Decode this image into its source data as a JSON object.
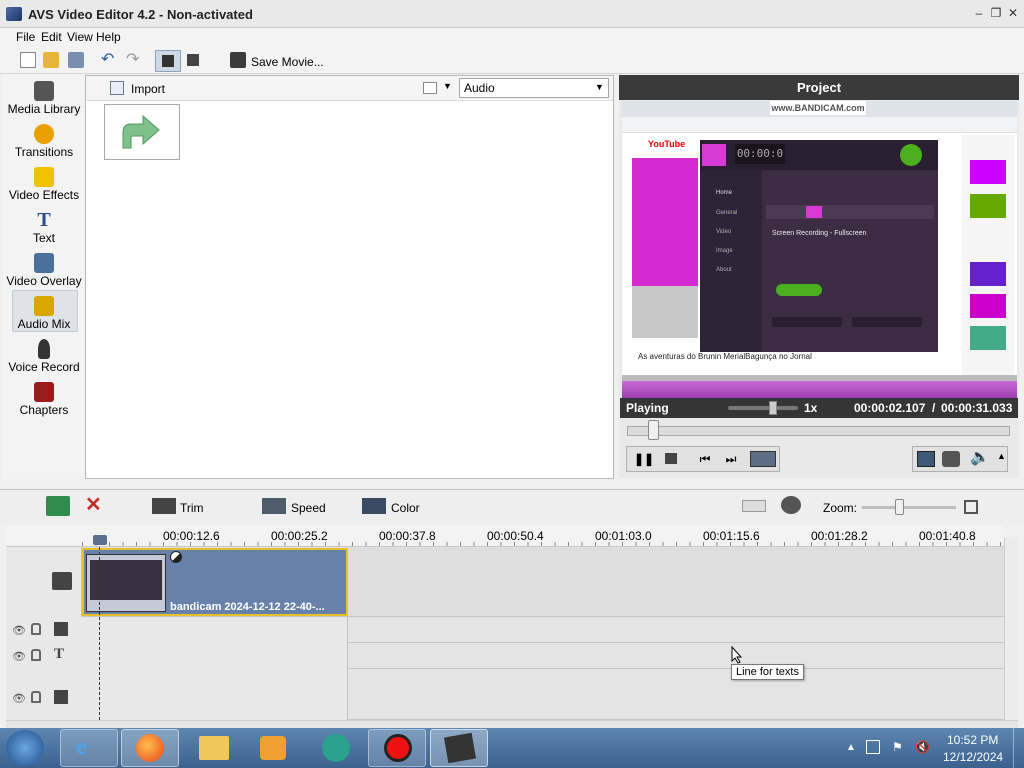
{
  "window": {
    "title": "AVS Video Editor 4.2 - Non-activated"
  },
  "menu": [
    "File",
    "Edit",
    "View",
    "Help"
  ],
  "toolbar": {
    "save_movie": "Save Movie..."
  },
  "sidebar": [
    {
      "label": "Media Library"
    },
    {
      "label": "Transitions"
    },
    {
      "label": "Video Effects"
    },
    {
      "label": "Text"
    },
    {
      "label": "Video Overlay"
    },
    {
      "label": "Audio Mix"
    },
    {
      "label": "Voice Record"
    },
    {
      "label": "Chapters"
    }
  ],
  "library": {
    "import_label": "Import",
    "filter_value": "Audio"
  },
  "project": {
    "title": "Project",
    "status": "Playing",
    "speed": "1x",
    "current_time": "00:00:02.107",
    "separator": "/",
    "total_time": "00:00:31.033",
    "progress": 0.068
  },
  "preview": {
    "watermark": "www.BANDICAM.com",
    "recorder_time": "00:00:0",
    "tab_youtube": "YouTube",
    "caption": "As aventuras do Brunin MerialBagunça no Jornal",
    "rec_menu": [
      "Home",
      "General",
      "Video",
      "Image",
      "About"
    ],
    "rec_heading": "Screen Recording - Fullscreen"
  },
  "timeline": {
    "trim": "Trim",
    "speed": "Speed",
    "color": "Color",
    "zoom": "Zoom:",
    "ticks": [
      "00:00:12.6",
      "00:00:25.2",
      "00:00:37.8",
      "00:00:50.4",
      "00:01:03.0",
      "00:01:15.6",
      "00:01:28.2",
      "00:01:40.8"
    ],
    "clip_name": "bandicam 2024-12-12 22-40-...",
    "tooltip": "Line for texts"
  },
  "taskbar": {
    "time": "10:52 PM",
    "date": "12/12/2024"
  }
}
